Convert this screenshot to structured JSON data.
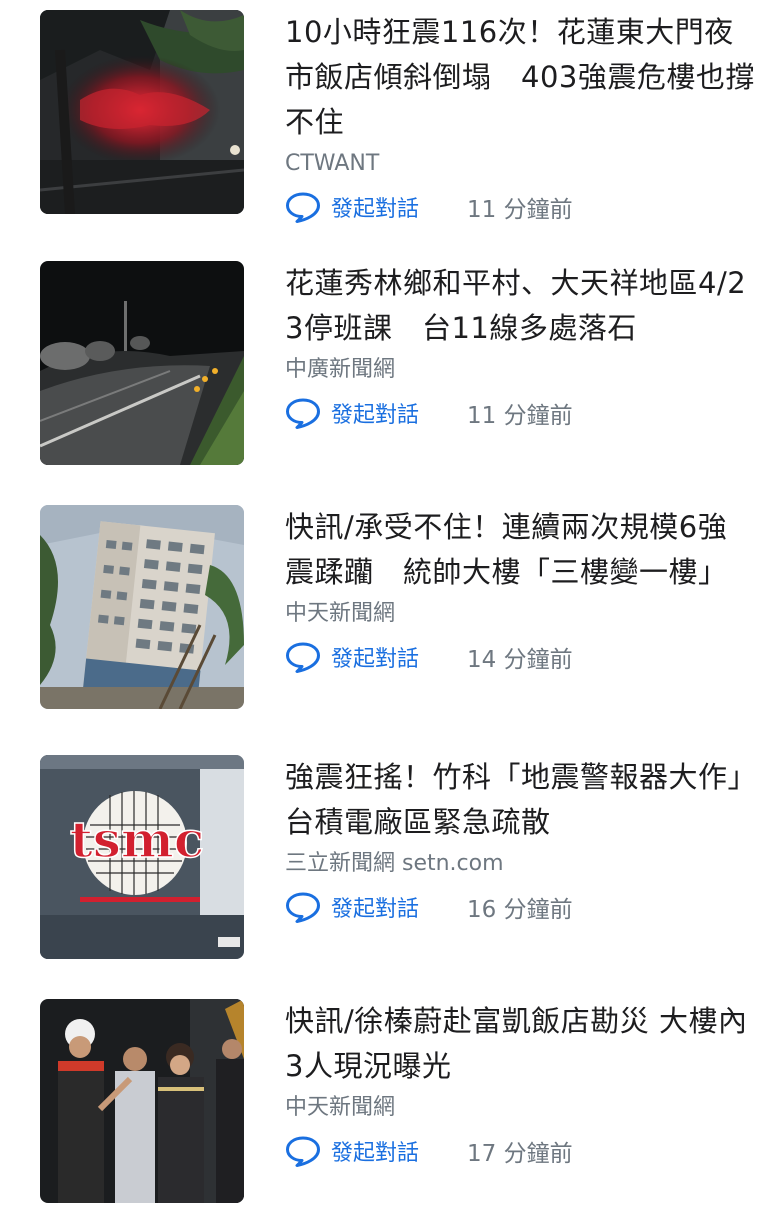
{
  "feed": {
    "items": [
      {
        "title": "10小時狂震116次！花蓮東大門夜市飯店傾斜倒塌　403強震危樓也撐不住",
        "source": "CTWANT",
        "comment_label": "發起對話",
        "time": "11 分鐘前",
        "thumb_icon": "collapsed-building-night-photo"
      },
      {
        "title": "花蓮秀林鄉和平村、大天祥地區4/23停班課　台11線多處落石",
        "source": "中廣新聞網",
        "comment_label": "發起對話",
        "time": "11 分鐘前",
        "thumb_icon": "road-rockfall-night-photo"
      },
      {
        "title": "快訊/承受不住！連續兩次規模6強震蹂躪　統帥大樓「三樓變一樓」",
        "source": "中天新聞網",
        "comment_label": "發起對話",
        "time": "14 分鐘前",
        "thumb_icon": "tilted-hotel-building-photo"
      },
      {
        "title": "強震狂搖！竹科「地震警報器大作」　台積電廠區緊急疏散",
        "source": "三立新聞網 setn.com",
        "comment_label": "發起對話",
        "time": "16 分鐘前",
        "thumb_icon": "tsmc-logo-sign-photo",
        "thumb_logo_text": "tsmc"
      },
      {
        "title": "快訊/徐榛蔚赴富凱飯店勘災 大樓內3人現況曝光",
        "source": "中天新聞網",
        "comment_label": "發起對話",
        "time": "17 分鐘前",
        "thumb_icon": "officials-inspection-photo"
      }
    ]
  },
  "colors": {
    "link_blue": "#1a6fe0",
    "meta_gray": "#6e7780",
    "text": "#1d1d1f"
  }
}
